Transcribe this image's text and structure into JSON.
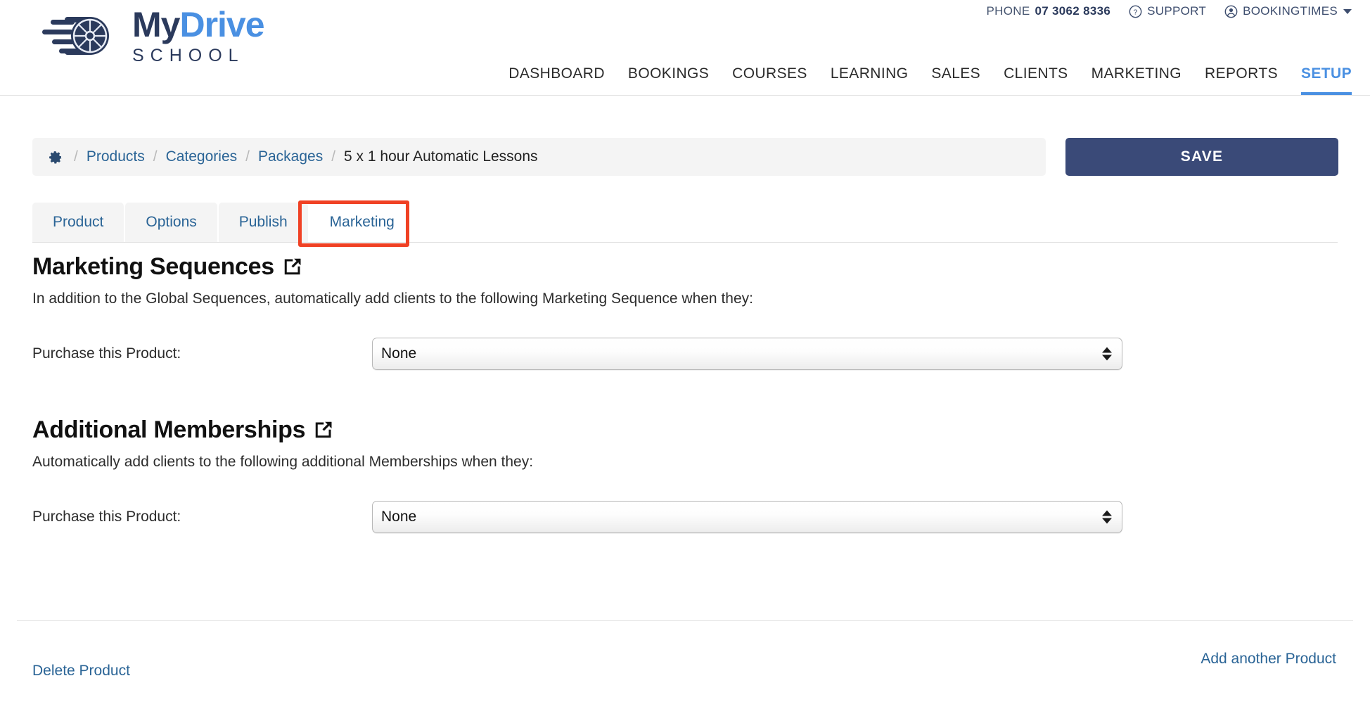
{
  "header": {
    "logo": {
      "line1_part1": "My",
      "line1_part2": "Drive",
      "line2": "SCHOOL",
      "mark_icon": "speeding-wheel-icon"
    },
    "utility": {
      "phone_label": "PHONE",
      "phone_number": "07 3062 8336",
      "support_label": "SUPPORT",
      "support_icon": "question-circle-icon",
      "account_label": "BOOKINGTIMES",
      "account_icon": "user-circle-icon",
      "caret_icon": "caret-down-icon"
    },
    "nav": [
      {
        "label": "DASHBOARD",
        "active": false
      },
      {
        "label": "BOOKINGS",
        "active": false
      },
      {
        "label": "COURSES",
        "active": false
      },
      {
        "label": "LEARNING",
        "active": false
      },
      {
        "label": "SALES",
        "active": false
      },
      {
        "label": "CLIENTS",
        "active": false
      },
      {
        "label": "MARKETING",
        "active": false
      },
      {
        "label": "REPORTS",
        "active": false
      },
      {
        "label": "SETUP",
        "active": true
      }
    ]
  },
  "breadcrumb": {
    "home_icon": "gear-icon",
    "separator": "/",
    "links": [
      "Products",
      "Categories",
      "Packages"
    ],
    "current": "5 x 1 hour Automatic Lessons"
  },
  "toolbar": {
    "save_label": "SAVE",
    "save_color": "#3a4a78"
  },
  "tabs": [
    {
      "label": "Product",
      "active": false,
      "highlighted": false
    },
    {
      "label": "Options",
      "active": false,
      "highlighted": false
    },
    {
      "label": "Publish",
      "active": false,
      "highlighted": false
    },
    {
      "label": "Marketing",
      "active": true,
      "highlighted": true
    }
  ],
  "highlight_color": "#f04124",
  "sections": [
    {
      "heading": "Marketing Sequences",
      "heading_icon": "external-link-icon",
      "description": "In addition to the Global Sequences, automatically add clients to the following Marketing Sequence when they:",
      "field_label": "Purchase this Product:",
      "field_value": "None",
      "field_options": [
        "None"
      ]
    },
    {
      "heading": "Additional Memberships",
      "heading_icon": "external-link-icon",
      "description": "Automatically add clients to the following additional Memberships when they:",
      "field_label": "Purchase this Product:",
      "field_value": "None",
      "field_options": [
        "None"
      ]
    }
  ],
  "footer": {
    "delete_label": "Delete Product",
    "add_label": "Add another Product"
  }
}
